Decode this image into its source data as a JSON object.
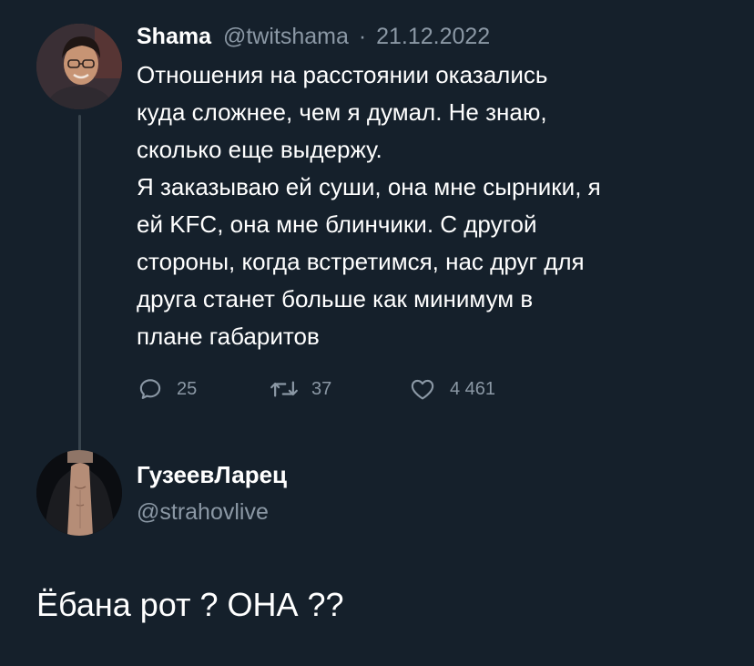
{
  "tweet": {
    "author_name": "Shama",
    "author_handle": "@twitshama",
    "separator": "·",
    "date": "21.12.2022",
    "text_lines": [
      "Отношения на расстоянии оказались",
      "куда сложнее, чем я думал. Не знаю,",
      "сколько еще выдержу.",
      "Я заказываю ей суши, она мне сырники, я",
      "ей KFC, она мне блинчики. С другой",
      "стороны, когда встретимся, нас друг для",
      "друга станет больше как минимум в",
      "плане габаритов"
    ],
    "replies_count": "25",
    "retweets_count": "37",
    "likes_count": "4 461"
  },
  "reply": {
    "author_name": "ГузеевЛарец",
    "author_handle": "@strahovlive",
    "text": "Ёбана рот ? ОНА ??"
  },
  "icons": {
    "reply": "speech-bubble-icon",
    "retweet": "retweet-arrows-icon",
    "like": "heart-outline-icon"
  },
  "colors": {
    "background": "#15202b",
    "primary_text": "#ffffff",
    "secondary_text": "#8b98a5",
    "thread_line": "#38444d"
  }
}
